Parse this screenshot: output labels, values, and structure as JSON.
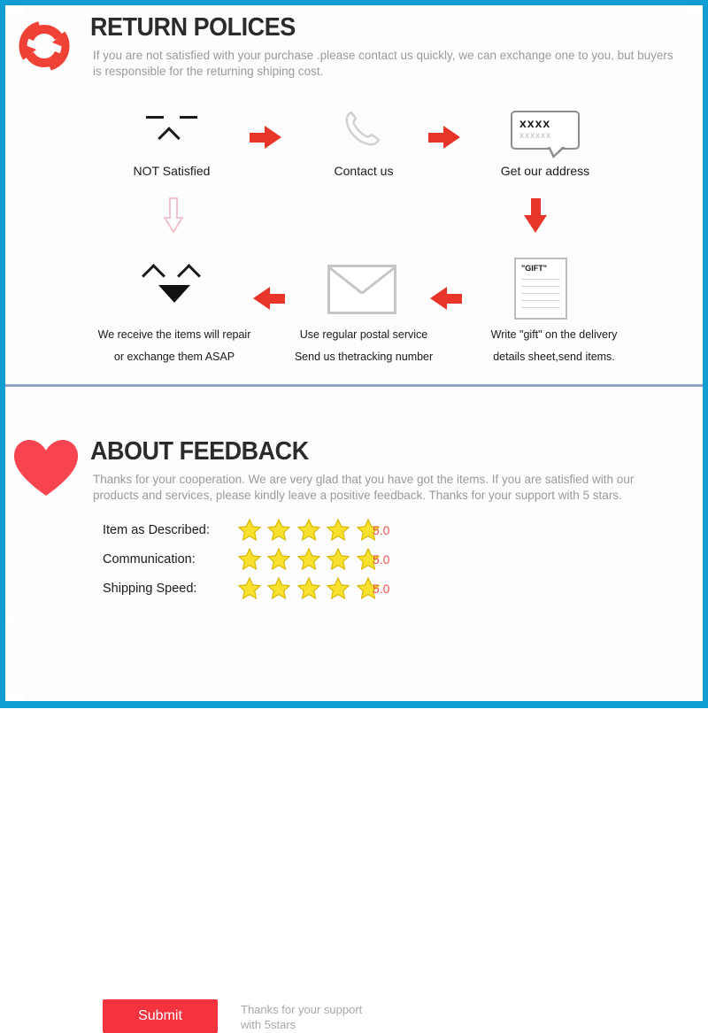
{
  "theme": {
    "frame_color": "#0f9ed1",
    "accent_red": "#e8352a",
    "submit_red": "#f5333f",
    "star_yellow": "#f7e12e",
    "divider_color": "#8fa3c2",
    "muted_text": "#9a9a9a"
  },
  "return_section": {
    "icon": "refresh-arrows-icon",
    "title": "RETURN POLICES",
    "subtitle": "If you are not satisfied with your purchase .please contact us quickly, we can exchange one to you, but buyers is responsible for the returning shiping cost.",
    "steps_top": [
      {
        "icon": "sad-face-icon",
        "caption": "NOT Satisfied"
      },
      {
        "icon": "phone-handset-icon",
        "caption": "Contact us"
      },
      {
        "icon": "speech-bubble-icon",
        "caption": "Get our address",
        "bubble_line1": "xxxx",
        "bubble_line2": "xxxxxx"
      }
    ],
    "steps_bottom": [
      {
        "icon": "happy-face-icon",
        "caption_line1": "We receive the items will repair",
        "caption_line2": "or exchange them ASAP"
      },
      {
        "icon": "envelope-icon",
        "caption_line1": "Use regular postal service",
        "caption_line2": "Send us thetracking number"
      },
      {
        "icon": "gift-document-icon",
        "doc_label": "\"GIFT\"",
        "caption_line1": "Write \"gift\" on the delivery",
        "caption_line2": "details sheet,send items."
      }
    ],
    "arrows": [
      {
        "name": "arrow-right-1",
        "direction": "right",
        "style": "solid"
      },
      {
        "name": "arrow-right-2",
        "direction": "right",
        "style": "solid"
      },
      {
        "name": "arrow-down-right",
        "direction": "down",
        "style": "solid"
      },
      {
        "name": "arrow-left-1",
        "direction": "left",
        "style": "solid"
      },
      {
        "name": "arrow-left-2",
        "direction": "left",
        "style": "solid"
      },
      {
        "name": "arrow-down-left",
        "direction": "down",
        "style": "hollow"
      }
    ]
  },
  "feedback_section": {
    "icon": "heart-icon",
    "title": "ABOUT FEEDBACK",
    "subtitle": "Thanks for your cooperation. We are very glad that you have got the items. If you are satisfied with our products and services, please kindly leave a positive feedback. Thanks for your support with 5 stars.",
    "ratings": [
      {
        "label": "Item as Described:",
        "stars": 5,
        "score": "5.0"
      },
      {
        "label": "Communication:",
        "stars": 5,
        "score": "5.0"
      },
      {
        "label": "Shipping Speed:",
        "stars": 5,
        "score": "5.0"
      }
    ],
    "submit_label": "Submit",
    "thanks_line1": "Thanks for your support",
    "thanks_line2": "with 5stars"
  }
}
